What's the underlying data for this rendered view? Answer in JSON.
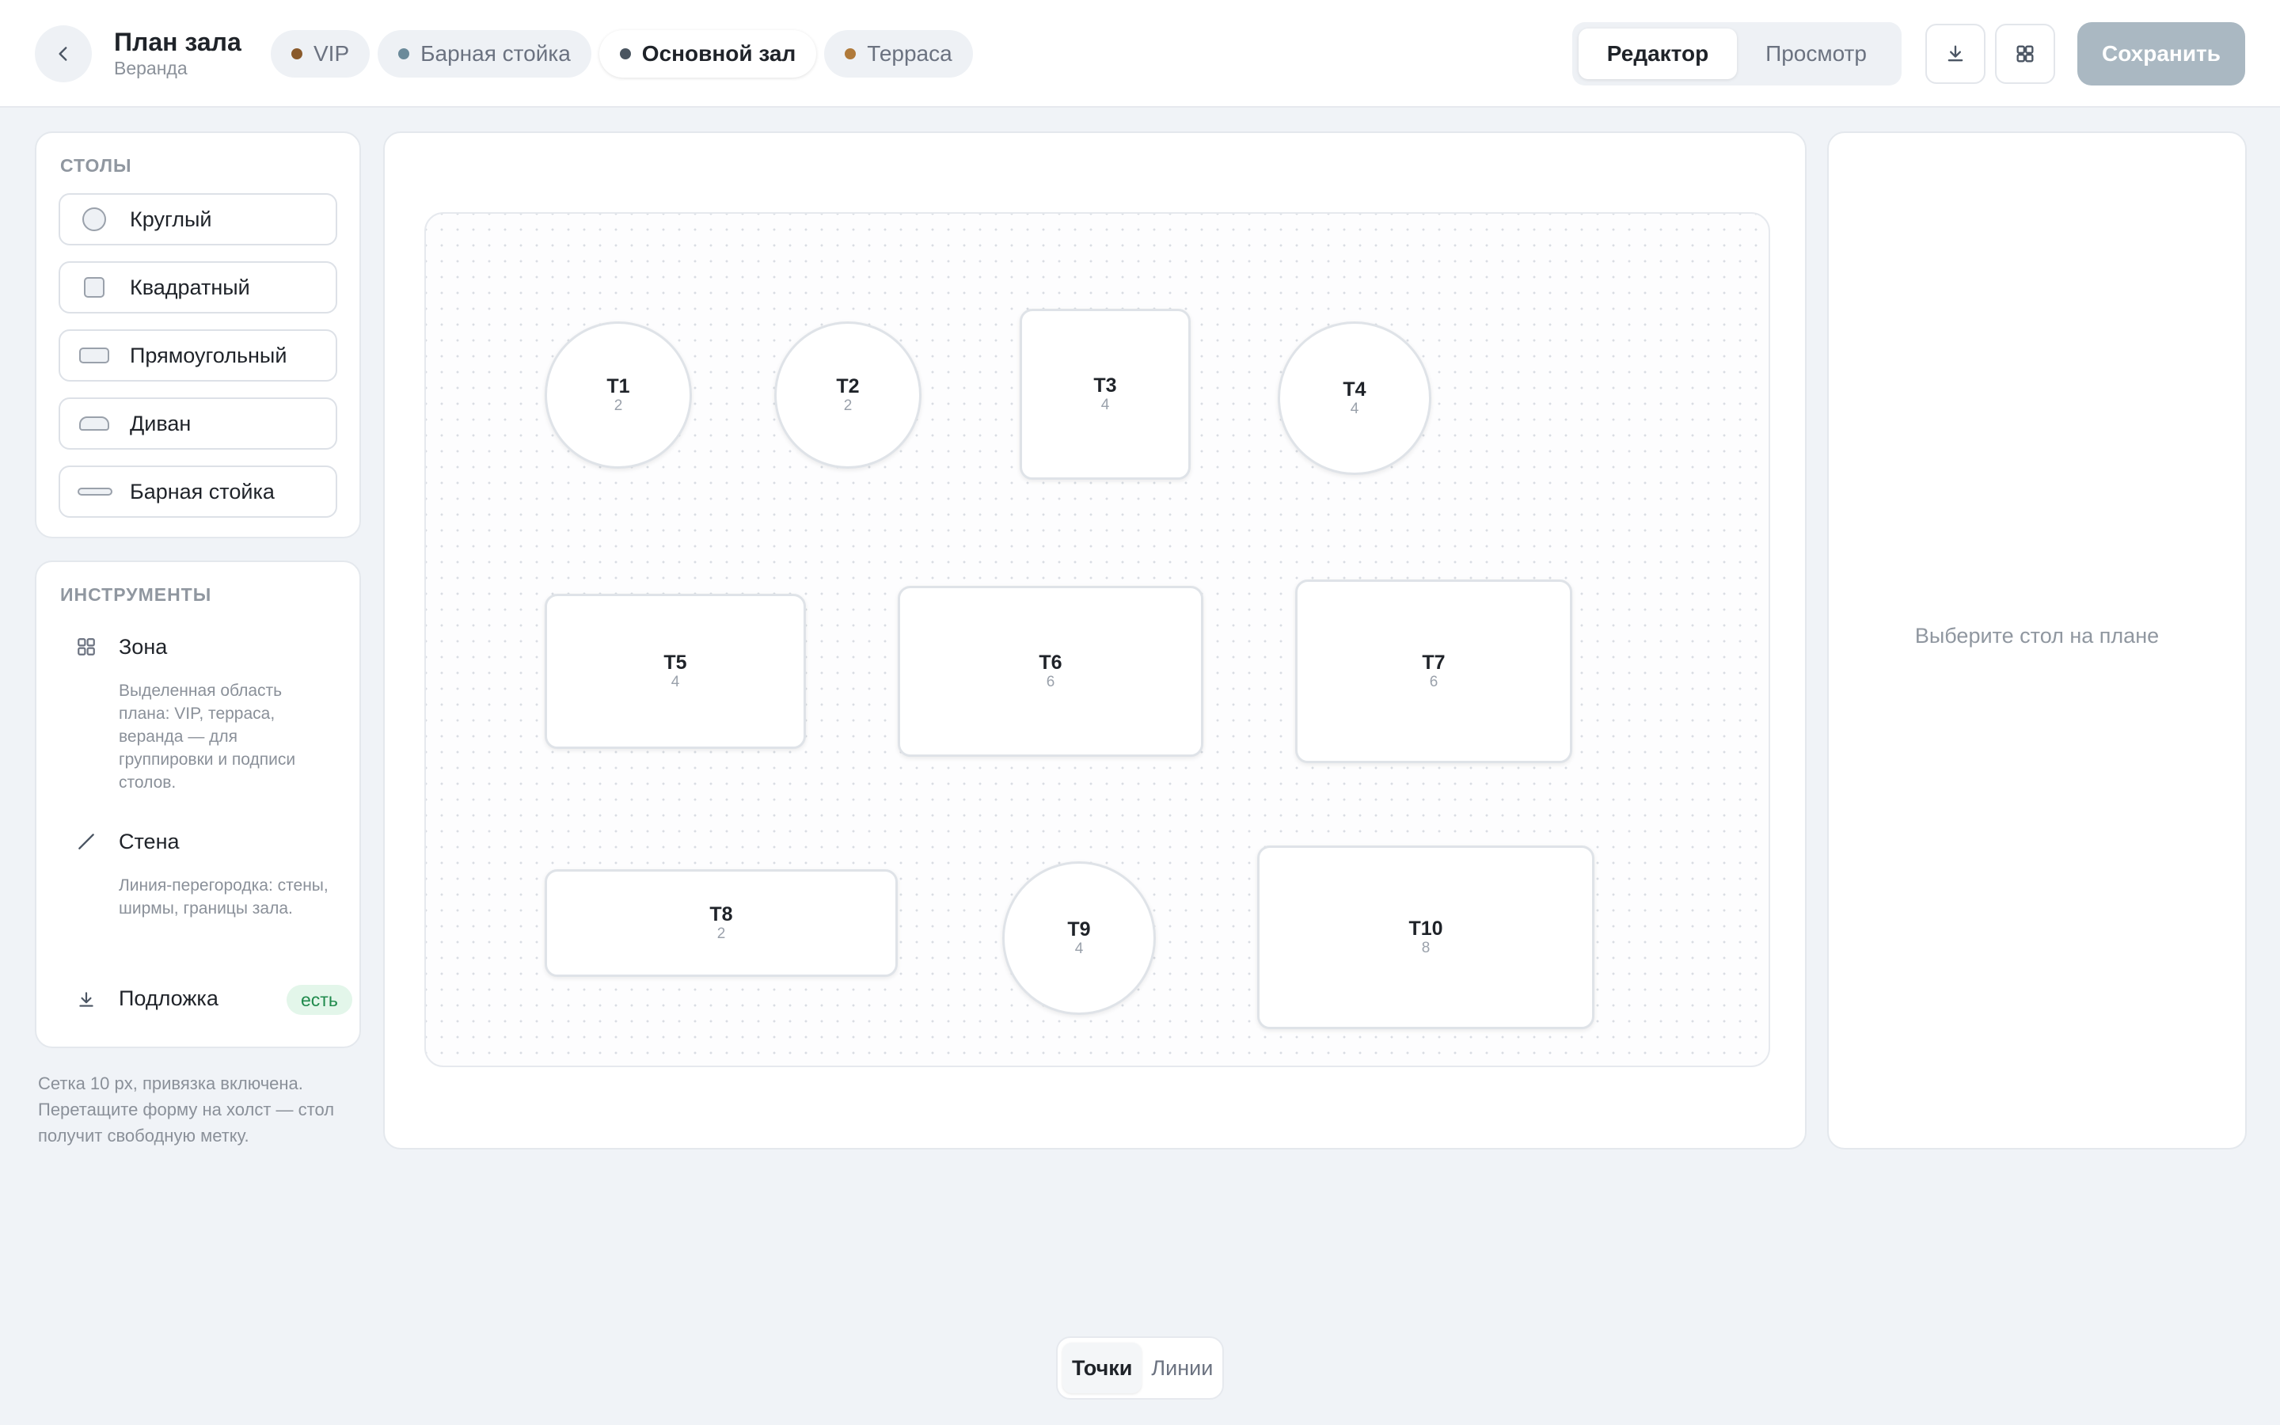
{
  "header": {
    "title": "План зала",
    "subtitle": "Веранда",
    "zones": [
      {
        "label": "VIP",
        "color": "#8a5a2b"
      },
      {
        "label": "Барная стойка",
        "color": "#6b8a9a"
      },
      {
        "label": "Основной зал",
        "color": "#4a5560"
      },
      {
        "label": "Терраса",
        "color": "#b07a3a"
      }
    ],
    "active_zone": "Основной зал",
    "modes": [
      "Редактор",
      "Просмотр"
    ],
    "active_mode": "Редактор",
    "save_label": "Сохранить"
  },
  "sidebar": {
    "tables_title": "СТОЛЫ",
    "shapes": [
      {
        "label": "Круглый",
        "icon": "circle-shape-icon"
      },
      {
        "label": "Квадратный",
        "icon": "square-shape-icon"
      },
      {
        "label": "Прямоугольный",
        "icon": "rectangle-shape-icon"
      },
      {
        "label": "Диван",
        "icon": "sofa-shape-icon"
      },
      {
        "label": "Барная стойка",
        "icon": "bar-counter-shape-icon"
      }
    ],
    "tools_title": "ИНСТРУМЕНТЫ",
    "tools": [
      {
        "label": "Зона",
        "icon": "grid-icon",
        "desc": "Выделенная область плана: VIP, терраса, веранда — для группировки и подписи столов."
      },
      {
        "label": "Стена",
        "icon": "line-icon",
        "desc": "Линия-перегородка: стены, ширмы, границы зала."
      },
      {
        "label": "Подложка",
        "icon": "download-icon",
        "badge": "есть"
      }
    ],
    "hint": "Сетка 10 px, привязка включена. Перетащите форму на холст — стол получит свободную метку."
  },
  "canvas": {
    "tables": [
      {
        "name": "T1",
        "seats": "2",
        "shape": "round"
      },
      {
        "name": "T2",
        "seats": "2",
        "shape": "round"
      },
      {
        "name": "T3",
        "seats": "4",
        "shape": "square"
      },
      {
        "name": "T4",
        "seats": "4",
        "shape": "round"
      },
      {
        "name": "T5",
        "seats": "4",
        "shape": "rectangle"
      },
      {
        "name": "T6",
        "seats": "6",
        "shape": "rectangle"
      },
      {
        "name": "T7",
        "seats": "6",
        "shape": "rectangle"
      },
      {
        "name": "T8",
        "seats": "2",
        "shape": "rectangle"
      },
      {
        "name": "T9",
        "seats": "4",
        "shape": "round"
      },
      {
        "name": "T10",
        "seats": "8",
        "shape": "rectangle"
      }
    ]
  },
  "info_panel": {
    "empty_text": "Выберите стол на плане"
  },
  "grid_toggle": {
    "options": [
      "Точки",
      "Линии"
    ],
    "active": "Точки"
  }
}
